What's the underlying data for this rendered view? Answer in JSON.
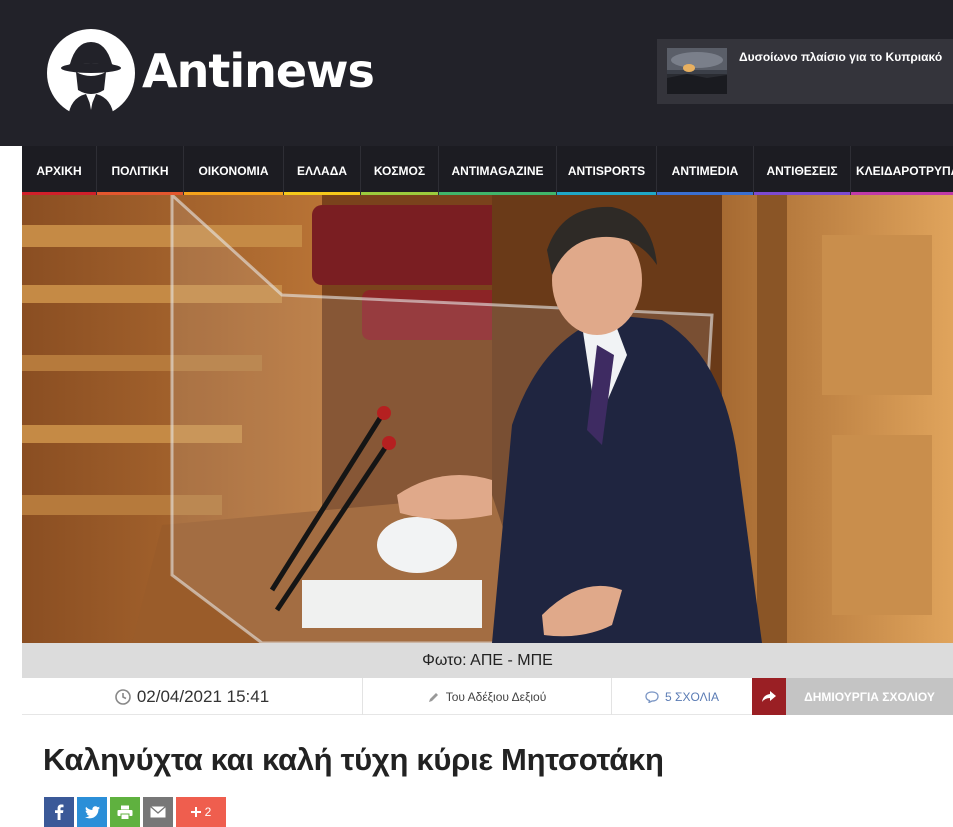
{
  "site": {
    "name": "Antinews",
    "promo_title": "Δυσοίωνο πλαίσιο για το Κυπριακό"
  },
  "nav": [
    {
      "label": "ΑΡΧΙΚΗ",
      "color": "#d0202a"
    },
    {
      "label": "ΠΟΛΙΤΙΚΗ",
      "color": "#e4572e"
    },
    {
      "label": "ΟΙΚΟΝΟΜΙΑ",
      "color": "#f6a31b"
    },
    {
      "label": "ΕΛΛΑΔΑ",
      "color": "#f6c91b"
    },
    {
      "label": "ΚΟΣΜΟΣ",
      "color": "#9ccc3d"
    },
    {
      "label": "ANTIMAGAZINE",
      "color": "#40b66b"
    },
    {
      "label": "ANTISPORTS",
      "color": "#1fa7c7"
    },
    {
      "label": "ANTIMEDIA",
      "color": "#3a6fd1"
    },
    {
      "label": "ΑΝΤΙΘΕΣΕΙΣ",
      "color": "#7d4ad1"
    },
    {
      "label": "ΚΛΕΙΔΑΡΟΤΡΥΠΑ",
      "color": "#c03aa8"
    }
  ],
  "article": {
    "photo_caption": "Φωτο: ΑΠΕ - ΜΠΕ",
    "date": "02/04/2021 15:41",
    "author": "Του Αδέξιου Δεξιού",
    "comments": "5 ΣΧΟΛΙΑ",
    "create_comment": "ΔΗΜΙΟΥΡΓΙΑ ΣΧΟΛΙΟΥ",
    "title": "Καληνύχτα και καλή τύχη κύριε Μητσοτάκη"
  },
  "share": {
    "more_count": "2",
    "icons": [
      "facebook-icon",
      "twitter-icon",
      "print-icon",
      "email-icon",
      "plus-icon"
    ]
  },
  "colors": {
    "header_bg": "#222229",
    "accent_red": "#9a1f24"
  }
}
